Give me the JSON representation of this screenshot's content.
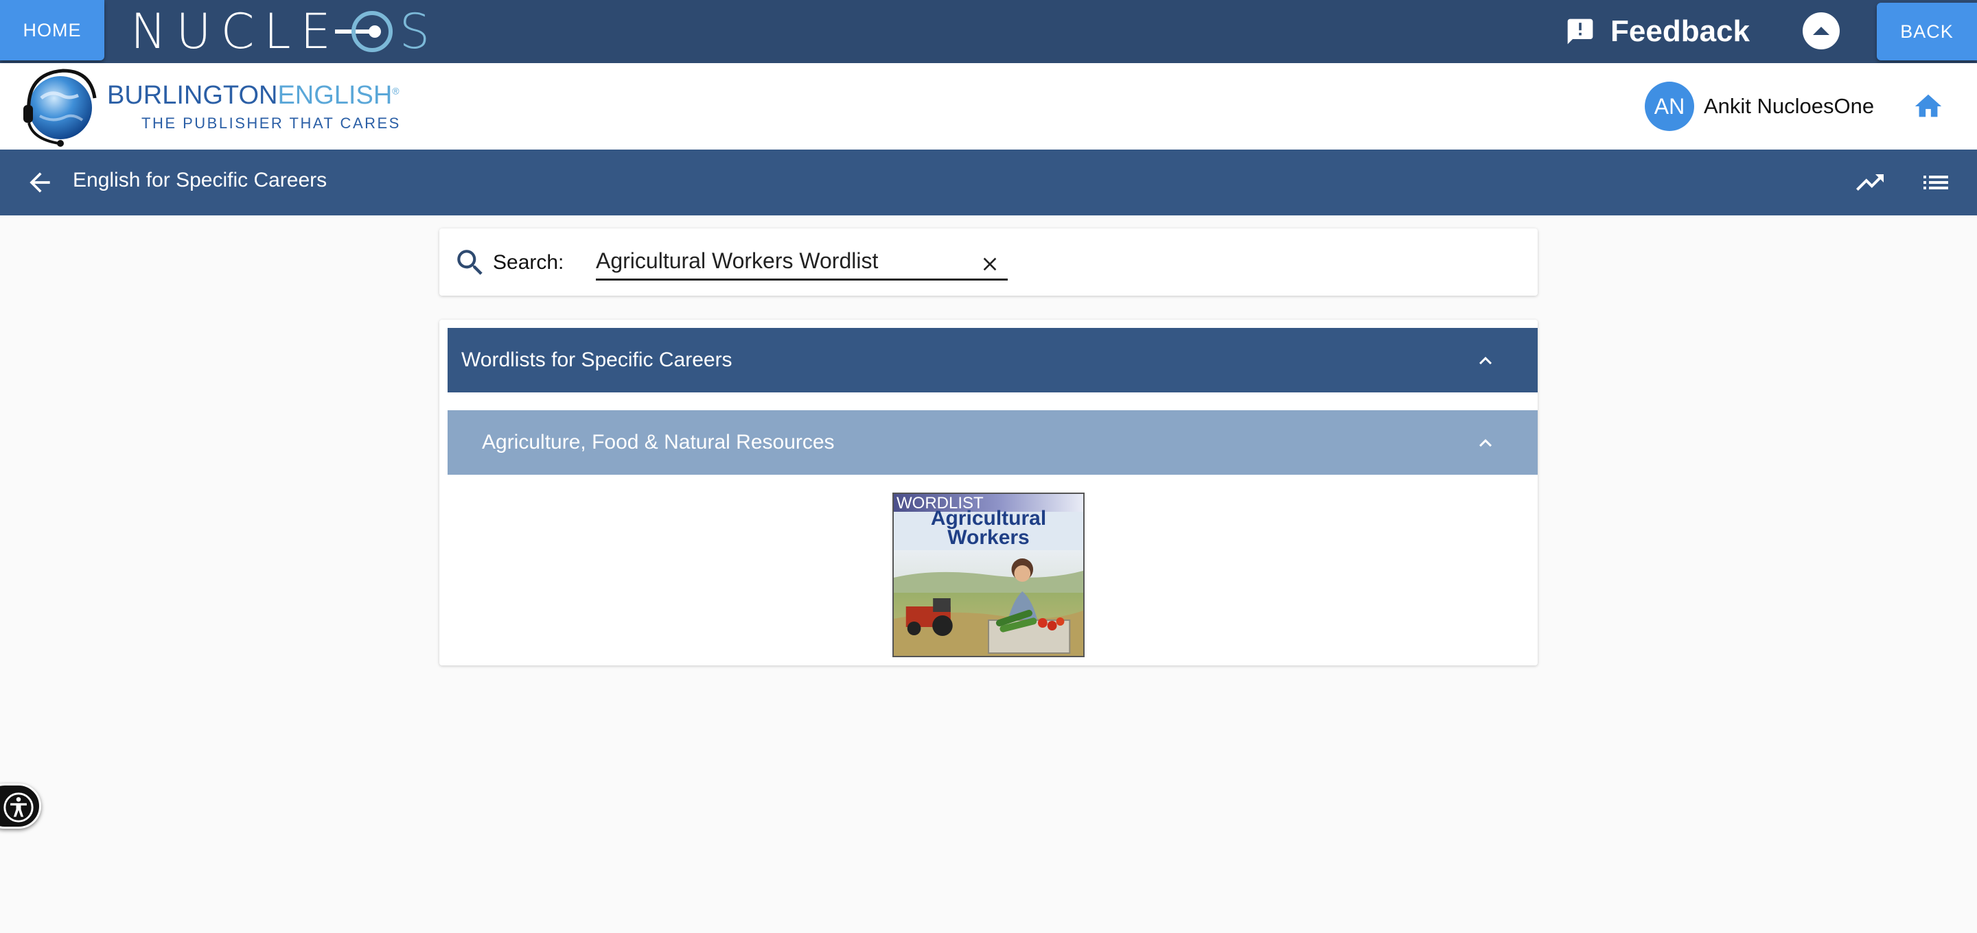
{
  "topbar": {
    "home_label": "HOME",
    "logo_text_a": "NUCLE",
    "logo_text_b": "S",
    "feedback_label": "Feedback",
    "back_label": "BACK"
  },
  "brand": {
    "name_bold": "BURLINGTON",
    "name_light": "ENGLISH",
    "registered": "®",
    "tagline": "THE PUBLISHER THAT CARES"
  },
  "user": {
    "initials": "AN",
    "name": "Ankit NucloesOne"
  },
  "course": {
    "title": "English for Specific Careers"
  },
  "search": {
    "label": "Search:",
    "value": "Agricultural Workers Wordlist"
  },
  "results": {
    "section_title": "Wordlists for Specific Careers",
    "subsection_title": "Agriculture, Food & Natural Resources",
    "tile": {
      "tag": "WORDLIST",
      "title_line1": "Agricultural",
      "title_line2": "Workers"
    }
  },
  "colors": {
    "topbar": "#2e4a70",
    "button_blue": "#4593e9",
    "course_bar": "#355784",
    "sub_header": "#8aa6c6",
    "avatar": "#3f8fe3"
  },
  "icons": [
    "feedback-icon",
    "scroll-up-icon",
    "globe-headset-logo",
    "home-icon",
    "arrow-back-icon",
    "trending-up-icon",
    "list-icon",
    "search-icon",
    "close-icon",
    "chevron-up-icon",
    "accessibility-icon"
  ]
}
